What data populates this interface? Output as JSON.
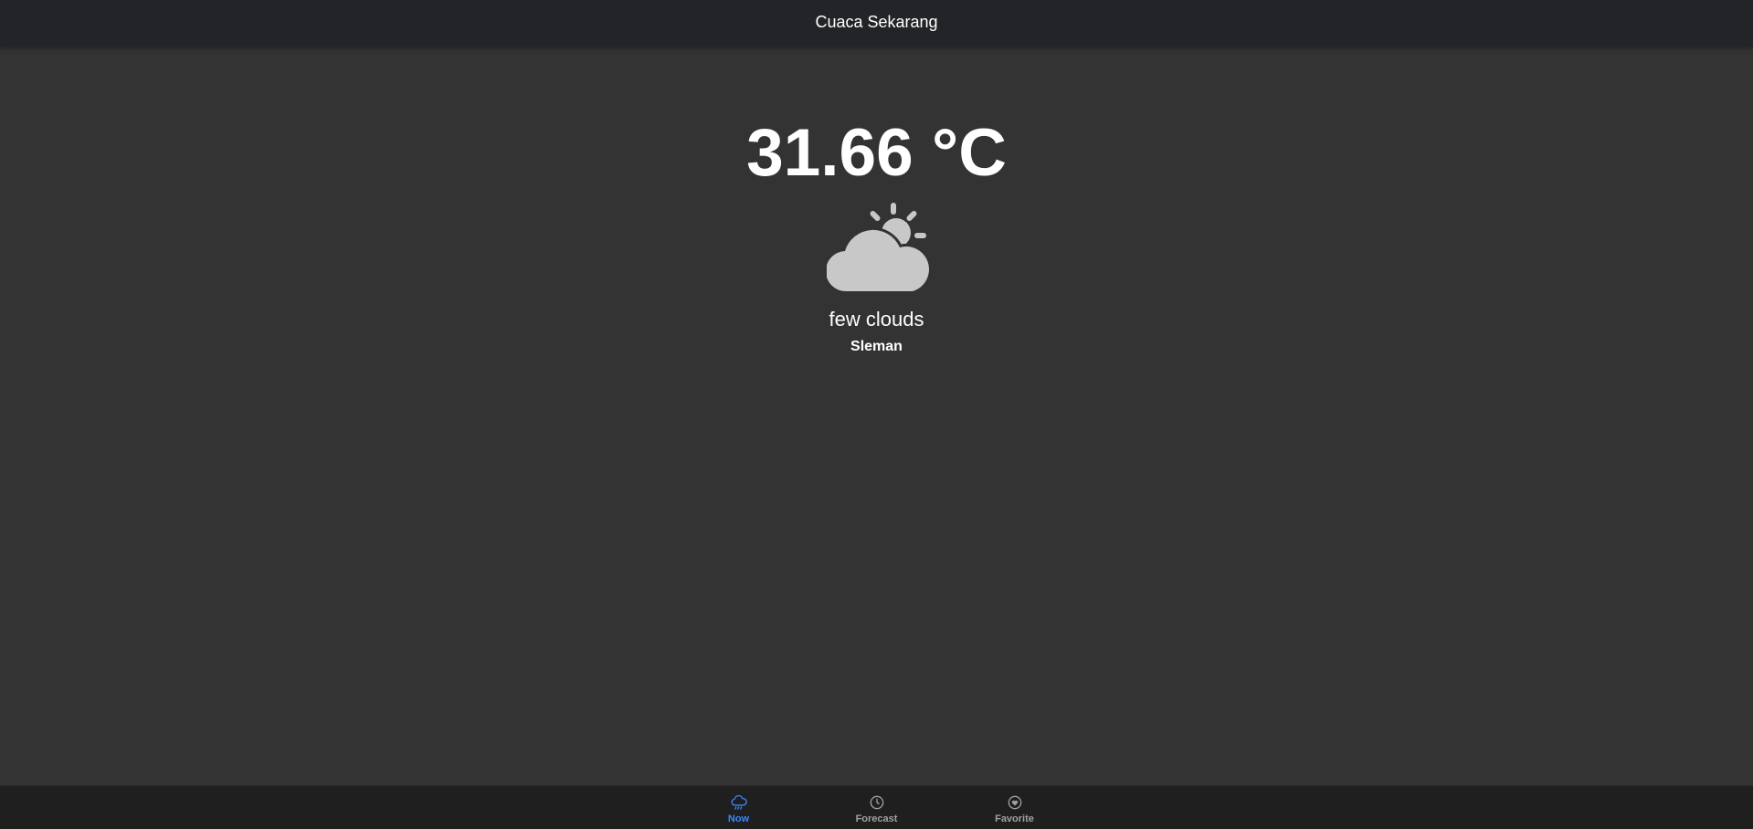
{
  "header": {
    "title": "Cuaca Sekarang"
  },
  "weather": {
    "temperature": "31.66 °C",
    "icon": "partly-cloudy-day-icon",
    "description": "few clouds",
    "location": "Sleman"
  },
  "tabs": [
    {
      "label": "Now",
      "icon": "cloud-rain-icon",
      "active": true
    },
    {
      "label": "Forecast",
      "icon": "clock-icon",
      "active": false
    },
    {
      "label": "Favorite",
      "icon": "heart-circle-icon",
      "active": false
    }
  ],
  "colors": {
    "background": "#333333",
    "header": "#222428",
    "tabbar": "#1f1f1f",
    "active_tab": "#3d86f5",
    "inactive_tab": "#a0a0a0",
    "icon_gray": "#c8c8c8"
  }
}
